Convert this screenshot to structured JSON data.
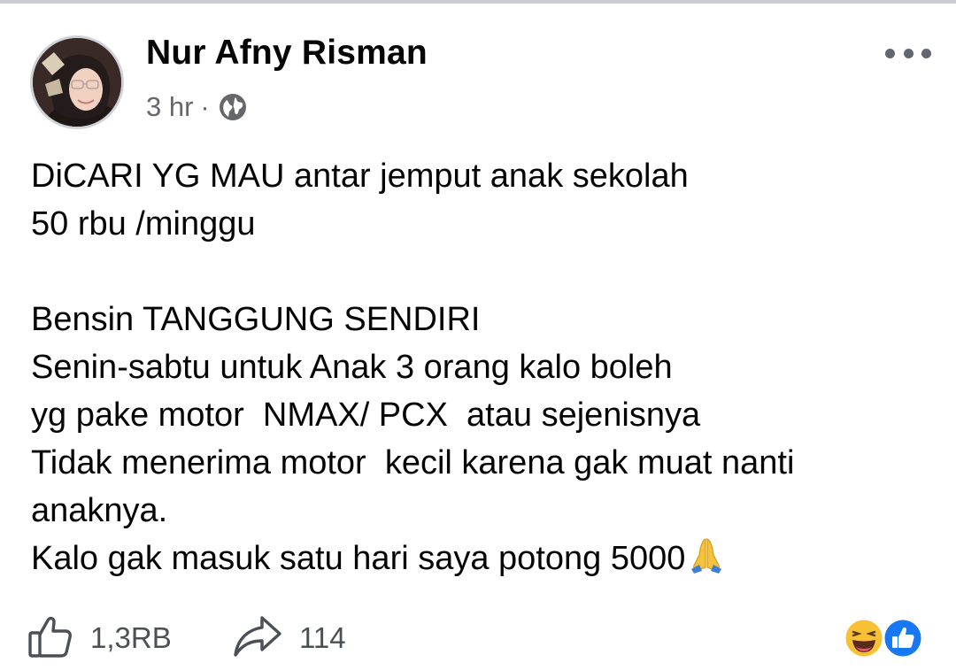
{
  "post": {
    "author": "Nur Afny Risman",
    "time": "3 hr",
    "separator": "·",
    "privacy_icon": "globe-icon",
    "menu_icon": "more-options-icon",
    "lines": [
      "DiCARI YG MAU antar jemput anak sekolah",
      "50 rbu /minggu",
      "",
      "Bensin TANGGUNG SENDIRI",
      "Senin-sabtu untuk Anak 3 orang kalo boleh",
      "yg pake motor  NMAX/ PCX  atau sejenisnya",
      "Tidak menerima motor  kecil karena gak muat nanti",
      "anaknya.",
      "Kalo gak masuk satu hari saya potong 5000"
    ],
    "trailing_emoji": "folded-hands-emoji"
  },
  "footer": {
    "like_count": "1,3RB",
    "share_count": "114",
    "like_icon": "thumbs-up-outline-icon",
    "share_icon": "share-arrow-icon",
    "reactions": [
      "haha-reaction-icon",
      "like-reaction-icon"
    ]
  },
  "colors": {
    "text": "#050505",
    "secondary": "#65676b",
    "facebook_blue": "#1877f2",
    "haha_yellow": "#f7c035"
  }
}
